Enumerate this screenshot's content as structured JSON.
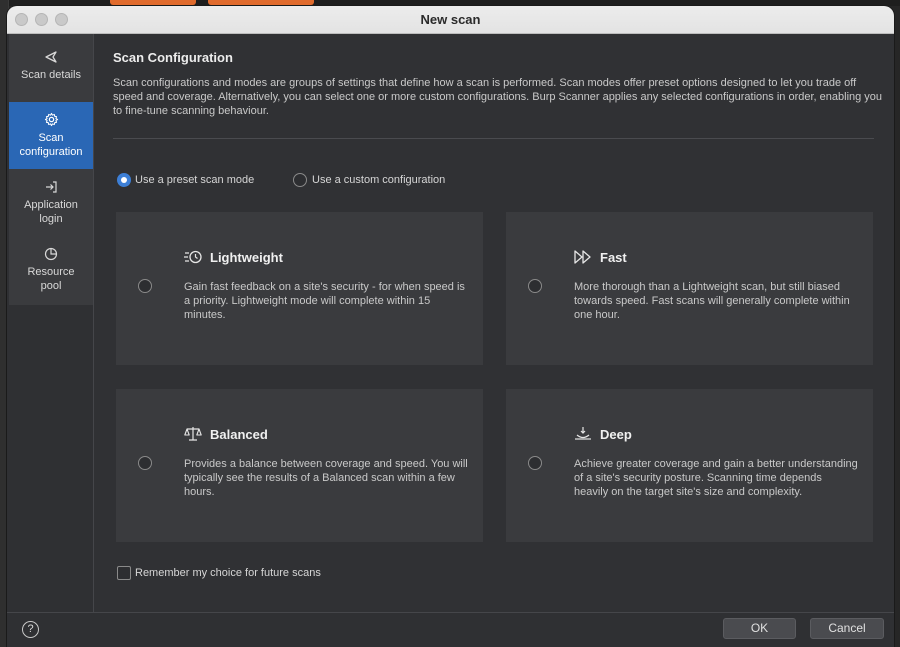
{
  "window": {
    "title": "New scan"
  },
  "sidebar": {
    "items": [
      {
        "label_line1": "Scan details",
        "label_line2": "",
        "icon": "send-arrow-icon"
      },
      {
        "label_line1": "Scan",
        "label_line2": "configuration",
        "icon": "gear-icon",
        "active": true
      },
      {
        "label_line1": "Application",
        "label_line2": "login",
        "icon": "login-arrow-icon"
      },
      {
        "label_line1": "Resource",
        "label_line2": "pool",
        "icon": "pie-chart-icon"
      }
    ]
  },
  "main": {
    "heading": "Scan Configuration",
    "description": "Scan configurations and modes are groups of settings that define how a scan is performed. Scan modes offer preset options designed to let you trade off speed and coverage. Alternatively, you can select one or more custom configurations. Burp Scanner applies any selected configurations in order, enabling you to fine-tune scanning behaviour.",
    "mode_options": [
      {
        "label": "Use a preset scan mode",
        "selected": true
      },
      {
        "label": "Use a custom configuration",
        "selected": false
      }
    ],
    "cards": [
      {
        "title": "Lightweight",
        "icon": "timer-speed-icon",
        "description": "Gain fast feedback on a site's security - for when speed is a priority. Lightweight mode will complete within 15 minutes."
      },
      {
        "title": "Fast",
        "icon": "fast-forward-icon",
        "description": "More thorough than a Lightweight scan, but still biased towards speed. Fast scans will generally complete within one hour."
      },
      {
        "title": "Balanced",
        "icon": "scales-icon",
        "description": "Provides a balance between coverage and speed. You will typically see the results of a Balanced scan within a few hours."
      },
      {
        "title": "Deep",
        "icon": "deep-dive-icon",
        "description": "Achieve greater coverage and gain a better understanding of a site's security posture. Scanning time depends heavily on the target site's size and complexity."
      }
    ],
    "remember_label": "Remember my choice for future scans"
  },
  "footer": {
    "help_symbol": "?",
    "ok_label": "OK",
    "cancel_label": "Cancel"
  },
  "colors": {
    "accent": "#2a67b5",
    "radio_selected": "#3d7fd6",
    "panel": "#3a3b3e",
    "background": "#303134"
  }
}
